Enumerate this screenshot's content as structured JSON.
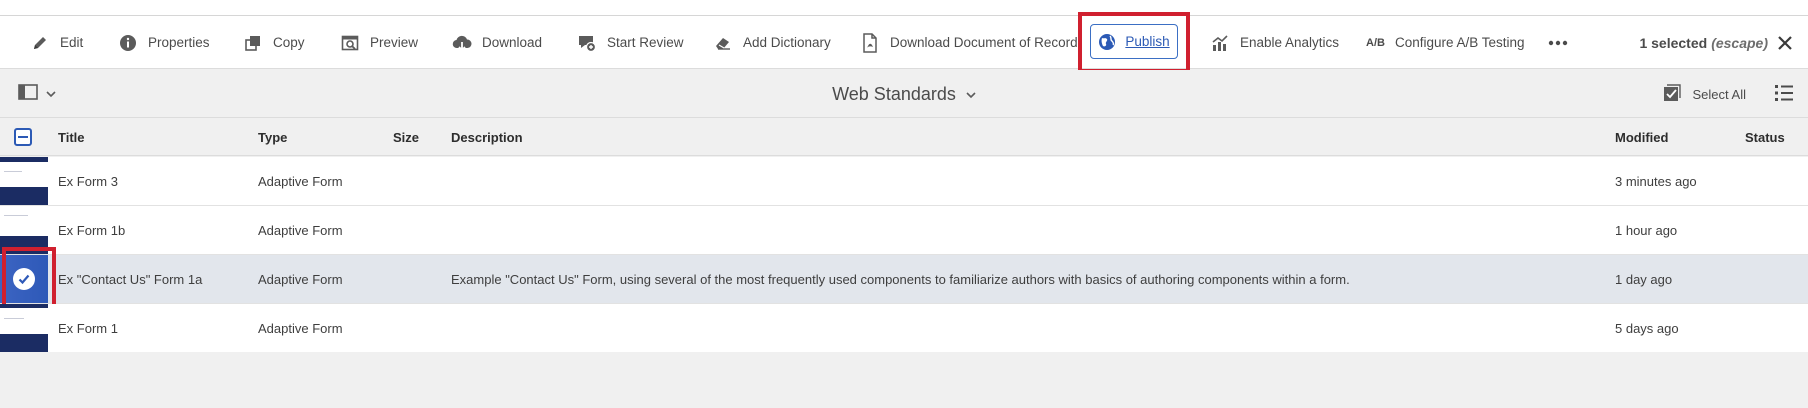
{
  "actionbar": {
    "actions": [
      {
        "label": "Edit",
        "icon": "pencil-icon"
      },
      {
        "label": "Properties",
        "icon": "info-icon"
      },
      {
        "label": "Copy",
        "icon": "copy-icon"
      },
      {
        "label": "Preview",
        "icon": "preview-icon"
      },
      {
        "label": "Download",
        "icon": "cloud-download-icon"
      },
      {
        "label": "Start Review",
        "icon": "review-icon"
      },
      {
        "label": "Add Dictionary",
        "icon": "eraser-icon"
      },
      {
        "label": "Download Document of Record",
        "icon": "pdf-document-icon"
      },
      {
        "label": "Publish",
        "icon": "globe-icon"
      },
      {
        "label": "Enable Analytics",
        "icon": "analytics-icon"
      },
      {
        "label": "Configure A/B Testing",
        "icon": "ab-testing-icon",
        "icon_text": "A/B"
      }
    ],
    "more_icon": "more-ellipsis-icon",
    "selection": {
      "count_text": "1 selected",
      "hint": "(escape)"
    },
    "close_icon": "close-icon"
  },
  "toolbar": {
    "folder_title": "Web Standards",
    "select_all_label": "Select All"
  },
  "table": {
    "columns": [
      "Title",
      "Type",
      "Size",
      "Description",
      "Modified",
      "Status"
    ],
    "rows": [
      {
        "title": "Ex Form 3",
        "type": "Adaptive Form",
        "size": "",
        "description": "",
        "modified": "3 minutes ago",
        "status": "",
        "selected": false
      },
      {
        "title": "Ex Form 1b",
        "type": "Adaptive Form",
        "size": "",
        "description": "",
        "modified": "1 hour ago",
        "status": "",
        "selected": false
      },
      {
        "title": "Ex \"Contact Us\" Form 1a",
        "type": "Adaptive Form",
        "size": "",
        "description": "Example \"Contact Us\" Form, using several of the most frequently used components to familiarize authors with basics of authoring components within a form.",
        "modified": "1 day ago",
        "status": "",
        "selected": true
      },
      {
        "title": "Ex Form 1",
        "type": "Adaptive Form",
        "size": "",
        "description": "",
        "modified": "5 days ago",
        "status": "",
        "selected": false
      }
    ]
  },
  "colors": {
    "accent": "#2c5ab5",
    "highlight_red": "#d0202f",
    "selected_row": "#e2e6ec",
    "thumb_navy": "#1b2c63"
  }
}
